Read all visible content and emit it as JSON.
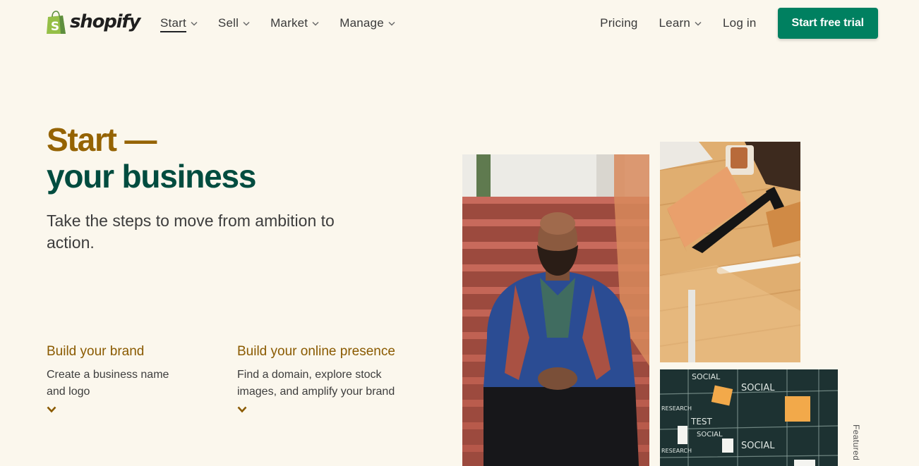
{
  "brand": {
    "name": "shopify",
    "logo_icon": "shopping-bag-icon",
    "logo_color": "#95bf47"
  },
  "nav": {
    "primary": [
      {
        "label": "Start",
        "has_dropdown": true,
        "active": true
      },
      {
        "label": "Sell",
        "has_dropdown": true
      },
      {
        "label": "Market",
        "has_dropdown": true
      },
      {
        "label": "Manage",
        "has_dropdown": true
      }
    ],
    "secondary": [
      {
        "label": "Pricing",
        "has_dropdown": false
      },
      {
        "label": "Learn",
        "has_dropdown": true
      },
      {
        "label": "Log in",
        "has_dropdown": false
      }
    ],
    "cta": "Start free trial",
    "cta_color": "#008060"
  },
  "hero": {
    "title_line1": "Start —",
    "title_line2": "your business",
    "title_line1_color": "#956303",
    "title_line2_color": "#004c3f",
    "subtitle": "Take the steps to move from ambition to action."
  },
  "features": [
    {
      "title": "Build your brand",
      "description": "Create a business name and logo",
      "icon": "chevron-down-icon"
    },
    {
      "title": "Build your online presence",
      "description": "Find a domain, explore stock images, and amplify your brand",
      "icon": "chevron-down-icon"
    }
  ],
  "photos": [
    {
      "name": "man-on-stairs-photo"
    },
    {
      "name": "leather-notebook-desk-photo"
    },
    {
      "name": "social-planning-board-photo",
      "board_words": [
        "SOCIAL",
        "SOCIAL",
        "TEST",
        "SOCIAL",
        "SOCIAL",
        "RESEARCH",
        "RESEARCH"
      ]
    }
  ],
  "featured_label": "Featured"
}
